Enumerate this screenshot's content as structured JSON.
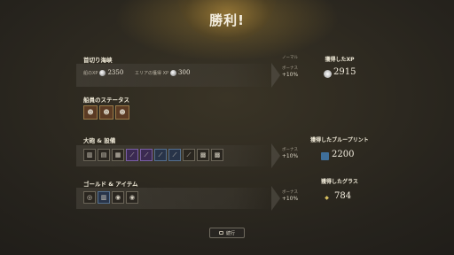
{
  "title": "勝利!",
  "sections": {
    "voyage": {
      "title": "首切り海峡",
      "ship_xp_label": "船のXP",
      "ship_xp": "2350",
      "region_xp_label": "エリアの獲得 XP",
      "region_xp": "300",
      "difficulty": "ノーマル",
      "bonus_label": "ボーナス",
      "bonus_value": "+10%",
      "reward_label": "獲得したXP",
      "reward_value": "2915"
    },
    "crew": {
      "title": "船員のステータス",
      "portraits": [
        {
          "icon": "crew-portrait"
        },
        {
          "icon": "crew-portrait"
        },
        {
          "icon": "crew-portrait"
        }
      ]
    },
    "cannons": {
      "title": "大砲 & 設備",
      "bonus_label": "ボーナス",
      "bonus_value": "+10%",
      "reward_label": "獲得したブループリント",
      "reward_value": "2200",
      "items": [
        {
          "glyph": "▥",
          "tier": "gray"
        },
        {
          "glyph": "▤",
          "tier": "gray"
        },
        {
          "glyph": "▦",
          "tier": "gray"
        },
        {
          "glyph": "⟋",
          "tier": "purple"
        },
        {
          "glyph": "⟋",
          "tier": "purple"
        },
        {
          "glyph": "⟋",
          "tier": "blue"
        },
        {
          "glyph": "⟋",
          "tier": "blue"
        },
        {
          "glyph": "⟋",
          "tier": "gray"
        },
        {
          "glyph": "▩",
          "tier": "gray"
        },
        {
          "glyph": "▩",
          "tier": "gray"
        }
      ]
    },
    "gold": {
      "title": "ゴールド & アイテム",
      "bonus_label": "ボーナス",
      "bonus_value": "+10%",
      "reward_label": "獲得したグラス",
      "reward_value": "784",
      "items": [
        {
          "glyph": "◎",
          "tier": "gray"
        },
        {
          "glyph": "▥",
          "tier": "blue"
        },
        {
          "glyph": "◉",
          "tier": "gray"
        },
        {
          "glyph": "◉",
          "tier": "gray"
        }
      ]
    }
  },
  "continue_label": "続行"
}
